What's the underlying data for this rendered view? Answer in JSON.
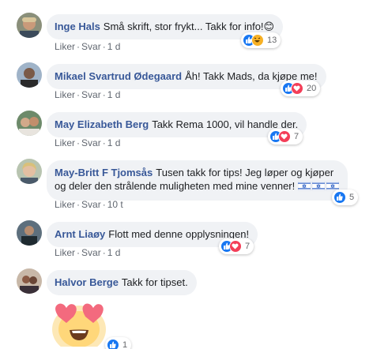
{
  "comments": [
    {
      "name": "Inge Hals",
      "text": "Små skrift, stor frykt... Takk for info!😊",
      "like": "Liker",
      "reply": "Svar",
      "time": "1 d",
      "reaction_count": "13",
      "reaction_icons": [
        "like-icon",
        "haha-icon"
      ]
    },
    {
      "name": "Mikael Svartrud Ødegaard",
      "text": "Åh! Takk Mads, da kjøpe me!",
      "like": "Liker",
      "reply": "Svar",
      "time": "1 d",
      "reaction_count": "20",
      "reaction_icons": [
        "like-icon",
        "love-icon"
      ]
    },
    {
      "name": "May Elizabeth Berg",
      "text": "Takk Rema 1000, vil handle der.",
      "like": "Liker",
      "reply": "Svar",
      "time": "1 d",
      "reaction_count": "7",
      "reaction_icons": [
        "like-icon",
        "love-icon"
      ]
    },
    {
      "name": "May-Britt F Tjomsås",
      "text_line1": "Tusen takk for tips! Jeg løper og kjøper",
      "text_line2": "og deler den strålende muligheten med mine venner!",
      "like": "Liker",
      "reply": "Svar",
      "time": "10 t",
      "reaction_count": "5",
      "reaction_icons": [
        "like-icon"
      ]
    },
    {
      "name": "Arnt Liaøy",
      "text": "Flott med denne opplysningen!",
      "like": "Liker",
      "reply": "Svar",
      "time": "1 d",
      "reaction_count": "7",
      "reaction_icons": [
        "like-icon",
        "love-icon"
      ]
    },
    {
      "name": "Halvor Berge",
      "text": "Takk for tipset.",
      "sticker": "heart-eyes-emoji-sticker",
      "reaction_count": "1",
      "reaction_icons": [
        "like-icon"
      ]
    }
  ],
  "colors": {
    "name": "#385898",
    "bubble": "#f0f2f5",
    "meta": "#616770",
    "like_blue": "#1877f2",
    "love_red": "#f33e58",
    "haha_yellow": "#f7b125"
  }
}
